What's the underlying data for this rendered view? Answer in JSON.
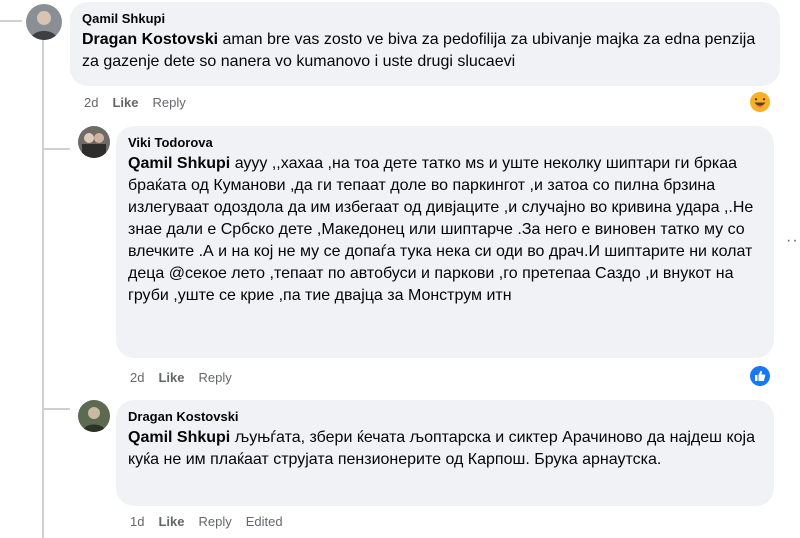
{
  "comments": [
    {
      "author": "Qamil Shkupi",
      "mention": "Dragan Kostovski",
      "text": " aman bre vas zosto ve biva za pedofilija za ubivanje majka za edna penzija za gazenje dete so nanera vo kumanovo i uste drugi slucaevi",
      "time": "2d",
      "like": "Like",
      "reply": "Reply",
      "reaction": "haha-icon"
    },
    {
      "author": "Viki Todorova",
      "mention": "Qamil Shkupi",
      "text": " аууу ,,хахаа ,на тоа дете татко мѕ и уште неколку шиптари ги бркаа браќата од Куманови ,да ги тепаат доле во паркингот ,и затоа со пилна брзина излегуваат одоздола да им избегаат од дивјаците ,и случајно во кривина удара ,.Не знае дали е Србско дете ,Македонец или шиптарче .За него е виновен татко му со влечките .А и на кој не му се допаѓа тука нека си оди во драч.И шиптарите ни колат деца @секое лето ,тепаат по автобуси и паркови ,го претепаа Саздо ,и внукот на груби ,уште се крие ,па тие двајца за Монструм итн",
      "time": "2d",
      "like": "Like",
      "reply": "Reply",
      "reaction": "like-icon",
      "more": "··"
    },
    {
      "author": "Dragan Kostovski",
      "mention": "Qamil Shkupi",
      "text": " љуњѓата, збери ќечата љоптарска и сиктер Арачиново да најдеш која куќа не им плаќаат струјата пензионерите од Карпош. Брука арнаутска.",
      "time": "1d",
      "like": "Like",
      "reply": "Reply",
      "edited": "Edited"
    }
  ],
  "colors": {
    "bubble": "#f0f2f5",
    "secondary_text": "#65676b",
    "like_blue": "#1877f2",
    "haha_yellow": "#f7b125",
    "thread_line": "#ced0d4"
  }
}
